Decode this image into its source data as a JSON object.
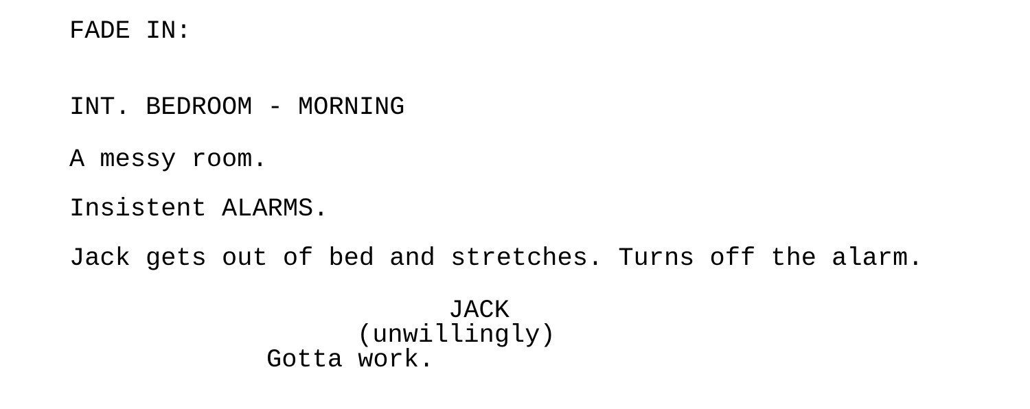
{
  "document": {
    "type": "screenplay",
    "background_color": "#ffffff",
    "text_color": "#000000",
    "lines": [
      {
        "element": "transition",
        "text": "FADE IN:"
      },
      {
        "element": "scene_heading",
        "text": "INT. BEDROOM - MORNING"
      },
      {
        "element": "action",
        "text": "A messy room."
      },
      {
        "element": "action",
        "text": "Insistent ALARMS."
      },
      {
        "element": "action",
        "text": "Jack gets out of bed and stretches. Turns off the alarm."
      },
      {
        "element": "character",
        "text": "JACK"
      },
      {
        "element": "parenthetical",
        "text": "(unwillingly)"
      },
      {
        "element": "dialogue",
        "text": "Gotta work."
      }
    ]
  }
}
